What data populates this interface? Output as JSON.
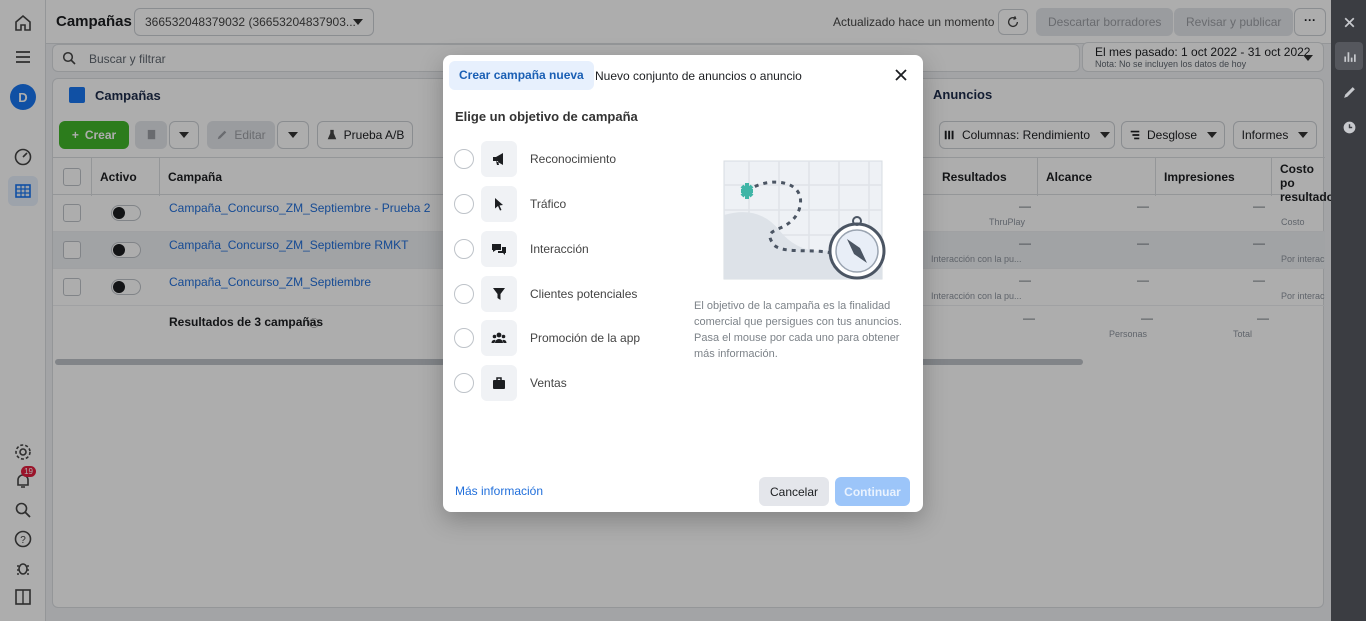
{
  "topbar": {
    "title": "Campañas",
    "account": "366532048379032 (36653204837903...",
    "updated": "Actualizado hace un momento",
    "discard_label": "Descartar borradores",
    "review_label": "Revisar y publicar",
    "more_label": "···"
  },
  "rail": {
    "avatar": "D",
    "notif_count": "19"
  },
  "search": {
    "placeholder": "Buscar y filtrar"
  },
  "date_range": {
    "label": "El mes pasado: 1 oct 2022 - 31 oct 2022",
    "note": "Nota: No se incluyen los datos de hoy"
  },
  "tabs": {
    "campaigns": "Campañas",
    "ads": "Anuncios"
  },
  "toolbar": {
    "create": "Crear",
    "edit": "Editar",
    "ab_test": "Prueba A/B",
    "columns": "Columnas: Rendimiento",
    "breakdown": "Desglose",
    "reports": "Informes"
  },
  "table": {
    "headers": {
      "active": "Activo",
      "campaign": "Campaña",
      "results": "Resultados",
      "reach": "Alcance",
      "impressions": "Impresiones",
      "cost": "Costo po resultado"
    },
    "rows": [
      {
        "name": "Campaña_Concurso_ZM_Septiembre - Prueba 2",
        "results_sub": "ThruPlay",
        "cost_sub": "Costo"
      },
      {
        "name": "Campaña_Concurso_ZM_Septiembre RMKT",
        "results_sub": "Interacción con la pu...",
        "cost_sub": "Por interac"
      },
      {
        "name": "Campaña_Concurso_ZM_Septiembre",
        "results_sub": "Interacción con la pu...",
        "cost_sub": "Por interac"
      }
    ],
    "summary": {
      "label": "Resultados de 3 campañas",
      "reach_sub": "Personas",
      "impressions_sub": "Total"
    },
    "dash": "—"
  },
  "modal": {
    "tab_active": "Crear campaña nueva",
    "tab_other": "Nuevo conjunto de anuncios o anuncio",
    "heading": "Elige un objetivo de campaña",
    "objectives": [
      {
        "label": "Reconocimiento",
        "icon": "megaphone-icon"
      },
      {
        "label": "Tráfico",
        "icon": "cursor-icon"
      },
      {
        "label": "Interacción",
        "icon": "chat-icon"
      },
      {
        "label": "Clientes potenciales",
        "icon": "funnel-icon"
      },
      {
        "label": "Promoción de la app",
        "icon": "people-icon"
      },
      {
        "label": "Ventas",
        "icon": "briefcase-icon"
      }
    ],
    "description": "El objetivo de la campaña es la finalidad comercial que persigues con tus anuncios. Pasa el mouse por cada uno para obtener más información.",
    "more_info": "Más información",
    "cancel": "Cancelar",
    "continue": "Continuar"
  },
  "colors": {
    "accent": "#1877f2",
    "create_green": "#42b72a",
    "continue_disabled": "#9cc5f9"
  }
}
